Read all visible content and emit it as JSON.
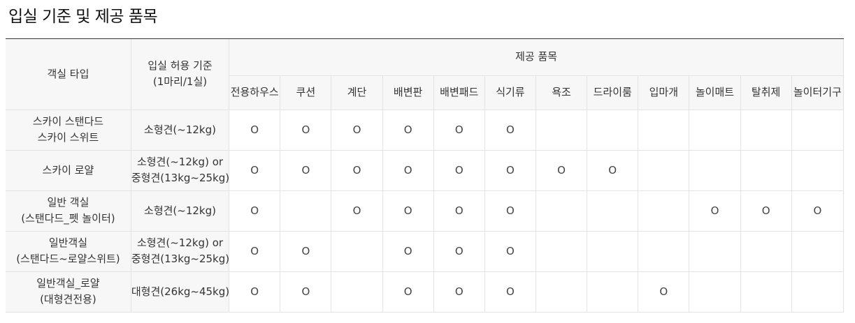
{
  "page_title": "입실 기준 및 제공 품목",
  "header": {
    "room_type": "객실 타입",
    "allowance_line1": "입실 허용 기준",
    "allowance_line2": "(1마리/1실)",
    "items_group": "제공 품목",
    "items": [
      "전용하우스",
      "쿠션",
      "계단",
      "배변판",
      "배변패드",
      "식기류",
      "욕조",
      "드라이룸",
      "입마개",
      "놀이매트",
      "탈취제",
      "놀이터기구"
    ]
  },
  "mark_symbol": "O",
  "rows": [
    {
      "room_lines": [
        "스카이 스탠다드",
        "스카이 스위트"
      ],
      "allowance_lines": [
        "소형견(~12kg)"
      ],
      "marks": [
        "O",
        "O",
        "O",
        "O",
        "O",
        "O",
        "",
        "",
        "",
        "",
        "",
        ""
      ]
    },
    {
      "room_lines": [
        "스카이 로얄"
      ],
      "allowance_lines": [
        "소형견(~12kg) or",
        "중형견(13kg~25kg)"
      ],
      "marks": [
        "O",
        "O",
        "O",
        "O",
        "O",
        "O",
        "O",
        "O",
        "",
        "",
        "",
        ""
      ]
    },
    {
      "room_lines": [
        "일반 객실",
        "(스탠다드_펫 놀이터)"
      ],
      "allowance_lines": [
        "소형견(~12kg)"
      ],
      "marks": [
        "O",
        "",
        "O",
        "O",
        "O",
        "O",
        "",
        "",
        "",
        "O",
        "O",
        "O"
      ]
    },
    {
      "room_lines": [
        "일반객실",
        "(스탠다드~로얄스위트)"
      ],
      "allowance_lines": [
        "소형견(~12kg) or",
        "중형견(13kg~25kg)"
      ],
      "marks": [
        "O",
        "O",
        "",
        "O",
        "O",
        "O",
        "",
        "",
        "",
        "",
        "",
        ""
      ]
    },
    {
      "room_lines": [
        "일반객실_로얄",
        "(대형견전용)"
      ],
      "allowance_lines": [
        "대형견(26kg~45kg)"
      ],
      "marks": [
        "O",
        "O",
        "",
        "O",
        "O",
        "O",
        "",
        "",
        "O",
        "",
        "",
        ""
      ]
    }
  ]
}
